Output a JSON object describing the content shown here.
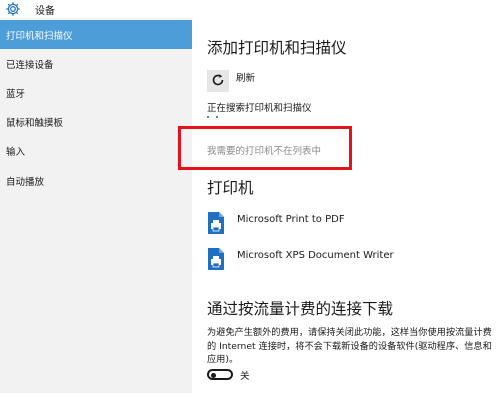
{
  "app": {
    "title": "设备",
    "icon": "gear-icon"
  },
  "sidebar": {
    "items": [
      {
        "label": "打印机和扫描仪",
        "active": true
      },
      {
        "label": "已连接设备"
      },
      {
        "label": "蓝牙"
      },
      {
        "label": "鼠标和触摸板"
      },
      {
        "label": "输入"
      },
      {
        "label": "自动播放"
      }
    ]
  },
  "main": {
    "add_section": {
      "title": "添加打印机和扫描仪",
      "refresh_label": "刷新",
      "refresh_icon": "refresh-icon",
      "searching_text": "正在搜索打印机和扫描仪",
      "not_listed_link": "我需要的打印机不在列表中"
    },
    "printers_section": {
      "title": "打印机",
      "printers": [
        {
          "name": "Microsoft Print to PDF",
          "icon": "printer-icon"
        },
        {
          "name": "Microsoft XPS Document Writer",
          "icon": "printer-icon"
        }
      ]
    },
    "metered_section": {
      "title": "通过按流量计费的连接下载",
      "description": "为避免产生额外的费用，请保持关闭此功能，这样当你使用按流量计费的 Internet 连接时，将不会下载新设备的设备软件(驱动程序、信息和应用)。",
      "toggle_state": "off",
      "toggle_label": "关"
    }
  },
  "colors": {
    "accent": "#4d9dd9",
    "sidebar_bg": "#f2f2f2",
    "highlight_box": "#e8101b",
    "printer_icon": "#1f6fc0"
  }
}
